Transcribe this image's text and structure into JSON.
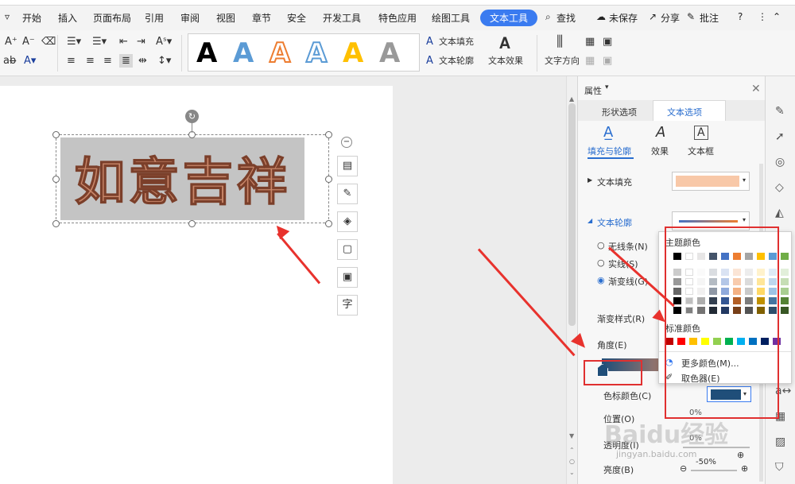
{
  "menu": {
    "tabs": [
      "开始",
      "插入",
      "页面布局",
      "引用",
      "审阅",
      "视图",
      "章节",
      "安全",
      "开发工具",
      "特色应用",
      "绘图工具",
      "文本工具"
    ],
    "active": "文本工具",
    "search": "查找",
    "unsaved": "未保存",
    "share": "分享",
    "annotate": "批注",
    "help": "?"
  },
  "ribbon": {
    "text_fill": "文本填充",
    "text_outline": "文本轮廓",
    "text_effect": "文本效果",
    "text_direction": "文字方向",
    "gallery_letter": "A"
  },
  "document": {
    "wordart_text": "如意吉祥"
  },
  "panel": {
    "title": "属性",
    "tabs": [
      "形状选项",
      "文本选项"
    ],
    "subtabs": [
      "填充与轮廓",
      "效果",
      "文本框"
    ],
    "text_fill": "文本填充",
    "text_outline": "文本轮廓",
    "no_line": "无线条(N)",
    "solid_line": "实线(S)",
    "gradient_line": "渐变线(G)",
    "gradient_style": "渐变样式(R)",
    "angle": "角度(E)",
    "stop_color": "色标颜色(C)",
    "position": "位置(O)",
    "transparency": "透明度(I)",
    "brightness": "亮度(B)",
    "brightness_value": "-50%",
    "pos_value": "0%",
    "trans_value": "0%"
  },
  "popup": {
    "theme_colors": "主题颜色",
    "standard_colors": "标准颜色",
    "more_colors": "更多颜色(M)...",
    "eyedropper": "取色器(E)"
  },
  "colors": {
    "theme_top": [
      "#000000",
      "#ffffff",
      "#e7e6e6",
      "#44546a",
      "#4472c4",
      "#ed7d31",
      "#a5a5a5",
      "#ffc000",
      "#5b9bd5",
      "#70ad47"
    ],
    "standard": [
      "#c00000",
      "#ff0000",
      "#ffc000",
      "#ffff00",
      "#92d050",
      "#00b050",
      "#00b0f0",
      "#0070c0",
      "#002060",
      "#7030a0"
    ],
    "stop_color": "#1f4e79",
    "fill_preview": "#f8c8a8"
  },
  "watermark": {
    "brand": "Baidu经验",
    "url": "jingyan.baidu.com"
  }
}
